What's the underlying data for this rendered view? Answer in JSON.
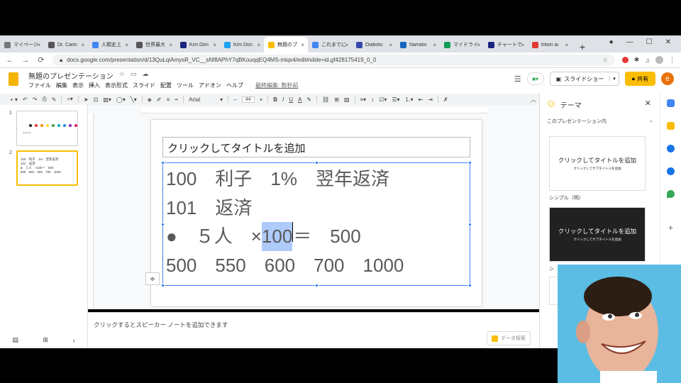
{
  "browser": {
    "tabs": [
      {
        "label": "マイページ",
        "color": "#777",
        "active": false
      },
      {
        "label": "Dr. Carin",
        "color": "#555",
        "active": false
      },
      {
        "label": "人類史上",
        "color": "#4285f4",
        "active": false
      },
      {
        "label": "世界最大",
        "color": "#555",
        "active": false
      },
      {
        "label": "Kim Don",
        "color": "#1a237e",
        "active": false
      },
      {
        "label": "Kim Don",
        "color": "#1da1f2",
        "active": false
      },
      {
        "label": "無題のプ",
        "color": "#fbbc04",
        "active": true
      },
      {
        "label": "これまでに",
        "color": "#4285f4",
        "active": false
      },
      {
        "label": "Diabolic",
        "color": "#3949ab",
        "active": false
      },
      {
        "label": "Narrativ",
        "color": "#1565c0",
        "active": false
      },
      {
        "label": "マイドライ",
        "color": "#0f9d58",
        "active": false
      },
      {
        "label": "チャートで",
        "color": "#1a237e",
        "active": false
      },
      {
        "label": "trilion ai",
        "color": "#e53935",
        "active": false
      }
    ],
    "url": "docs.google.com/presentation/d/13QuLqiAmysR_VC__sNf8APhY7qBKouqqEQ4MS-miqx4/edit#slide=id.gf428175419_0_0"
  },
  "docs": {
    "title": "無題のプレゼンテーション",
    "menus": [
      "ファイル",
      "編集",
      "表示",
      "挿入",
      "表示形式",
      "スライド",
      "配置",
      "ツール",
      "アドオン",
      "ヘルプ"
    ],
    "last_edit": "最終編集: 数秒前",
    "present_label": "スライドショー",
    "share_label": "共有",
    "user_initial": "e"
  },
  "toolbar": {
    "font": "Arial",
    "font_size": "44"
  },
  "thumbnails": {
    "slide1_num": "1",
    "slide2_num": "2",
    "dot_colors": [
      "#222222",
      "#e53935",
      "#fb8c00",
      "#fdd835",
      "#43a047",
      "#00acc1",
      "#1e88e5",
      "#8e24aa",
      "#d81b60"
    ],
    "slide1_caption": "sirilonom",
    "slide2_lines": [
      "100　利子　1%　翌年返済",
      "101　返済",
      "●　５人　×100＝　500",
      "500　550　600　700　1000"
    ]
  },
  "slide": {
    "title_placeholder": "クリックしてタイトルを追加",
    "line1": "100　利子　1%　翌年返済",
    "line2": "101　返済",
    "line3_bullet": "●",
    "line3_pre": "　５人　×",
    "line3_hl": "100",
    "line3_post": "＝　500",
    "line4": "500　550　600　700　1000"
  },
  "notes": {
    "placeholder": "クリックするとスピーカー ノートを追加できます",
    "explore": "データ探索"
  },
  "theme_panel": {
    "title": "テーマ",
    "section": "このプレゼンテーション内",
    "card1_title": "クリックしてタイトルを追加",
    "card1_sub": "クリックしてサブタイトルを追加",
    "card1_name": "シンプル（明）",
    "card2_title": "クリックしてタイトルを追加",
    "card2_sub": "クリックしてサブタイトルを追加",
    "card2_name": "シ"
  }
}
